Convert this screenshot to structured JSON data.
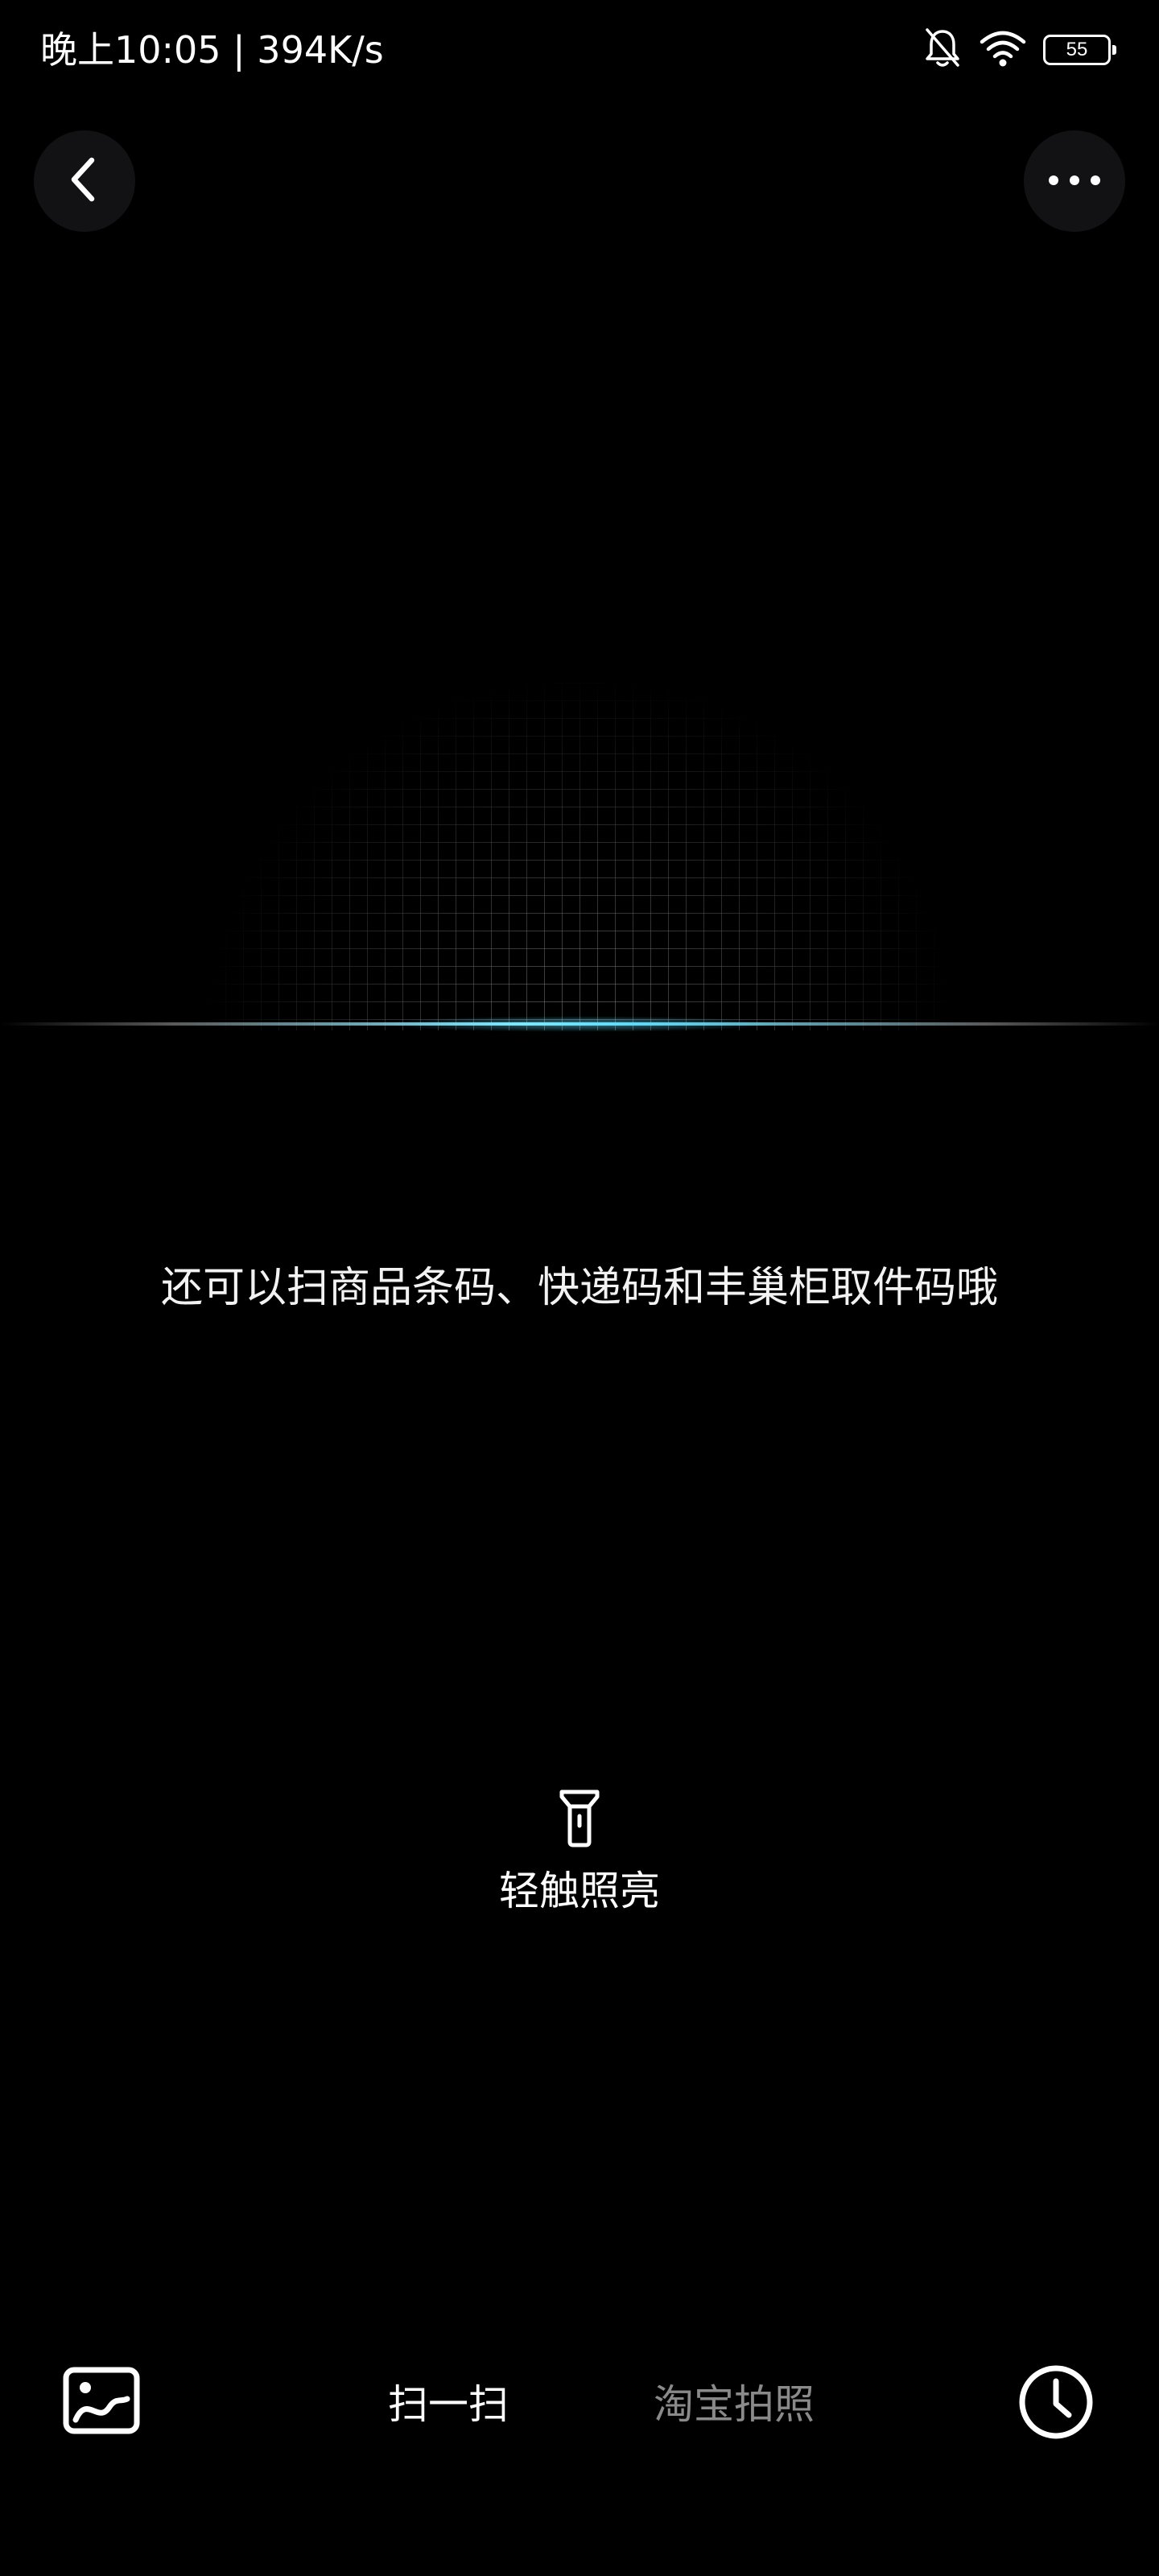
{
  "status_bar": {
    "time_speed": "晚上10:05 | 394K/s",
    "battery_level": "55",
    "icons": [
      "mute-bell-icon",
      "wifi-icon",
      "battery-icon"
    ]
  },
  "header": {
    "back_icon": "chevron-left-icon",
    "more_icon": "more-horizontal-icon"
  },
  "scanner": {
    "hint": "还可以扫商品条码、快递码和丰巢柜取件码哦",
    "scan_line_color": "#6fe2ff"
  },
  "flashlight": {
    "icon": "flashlight-icon",
    "label": "轻触照亮"
  },
  "bottom_bar": {
    "album_icon": "image-icon",
    "tabs": [
      {
        "label": "扫一扫",
        "active": true
      },
      {
        "label": "淘宝拍照",
        "active": false
      }
    ],
    "history_icon": "clock-icon",
    "active_color": "#ffffff",
    "inactive_color": "#8a8a8a"
  }
}
